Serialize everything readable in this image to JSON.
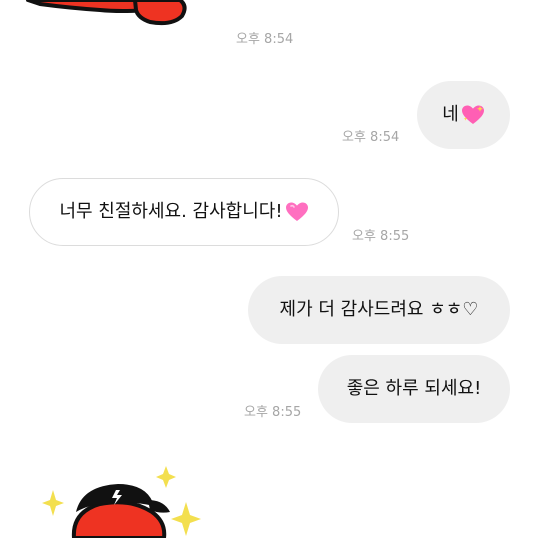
{
  "messages": [
    {
      "side": "out",
      "text": "네",
      "emoji": "sparkling-heart-icon"
    },
    {
      "side": "in",
      "text": "너무 친절하세요. 감사합니다!",
      "emoji": "pink-heart-icon"
    },
    {
      "side": "out",
      "text": "제가 더 감사드려요 ㅎㅎ♡"
    },
    {
      "side": "out",
      "text": "좋은 하루 되세요!"
    }
  ],
  "timestamps": {
    "t1": "오후 8:54",
    "t2": "오후 8:54",
    "t3": "오후 8:55",
    "t4": "오후 8:55"
  },
  "colors": {
    "outgoing_bubble": "#efefef",
    "incoming_border": "#dcdcdc",
    "sticker_red": "#ee3322",
    "sparkle_yellow": "#f3df4f",
    "heart_pink": "#ff5fb4"
  },
  "stickers": [
    {
      "name": "top-sticker-partial",
      "description_icon": "red-character-sticker-icon"
    },
    {
      "name": "bottom-sticker-partial",
      "description_icon": "red-character-with-cap-sticker-icon"
    }
  ]
}
